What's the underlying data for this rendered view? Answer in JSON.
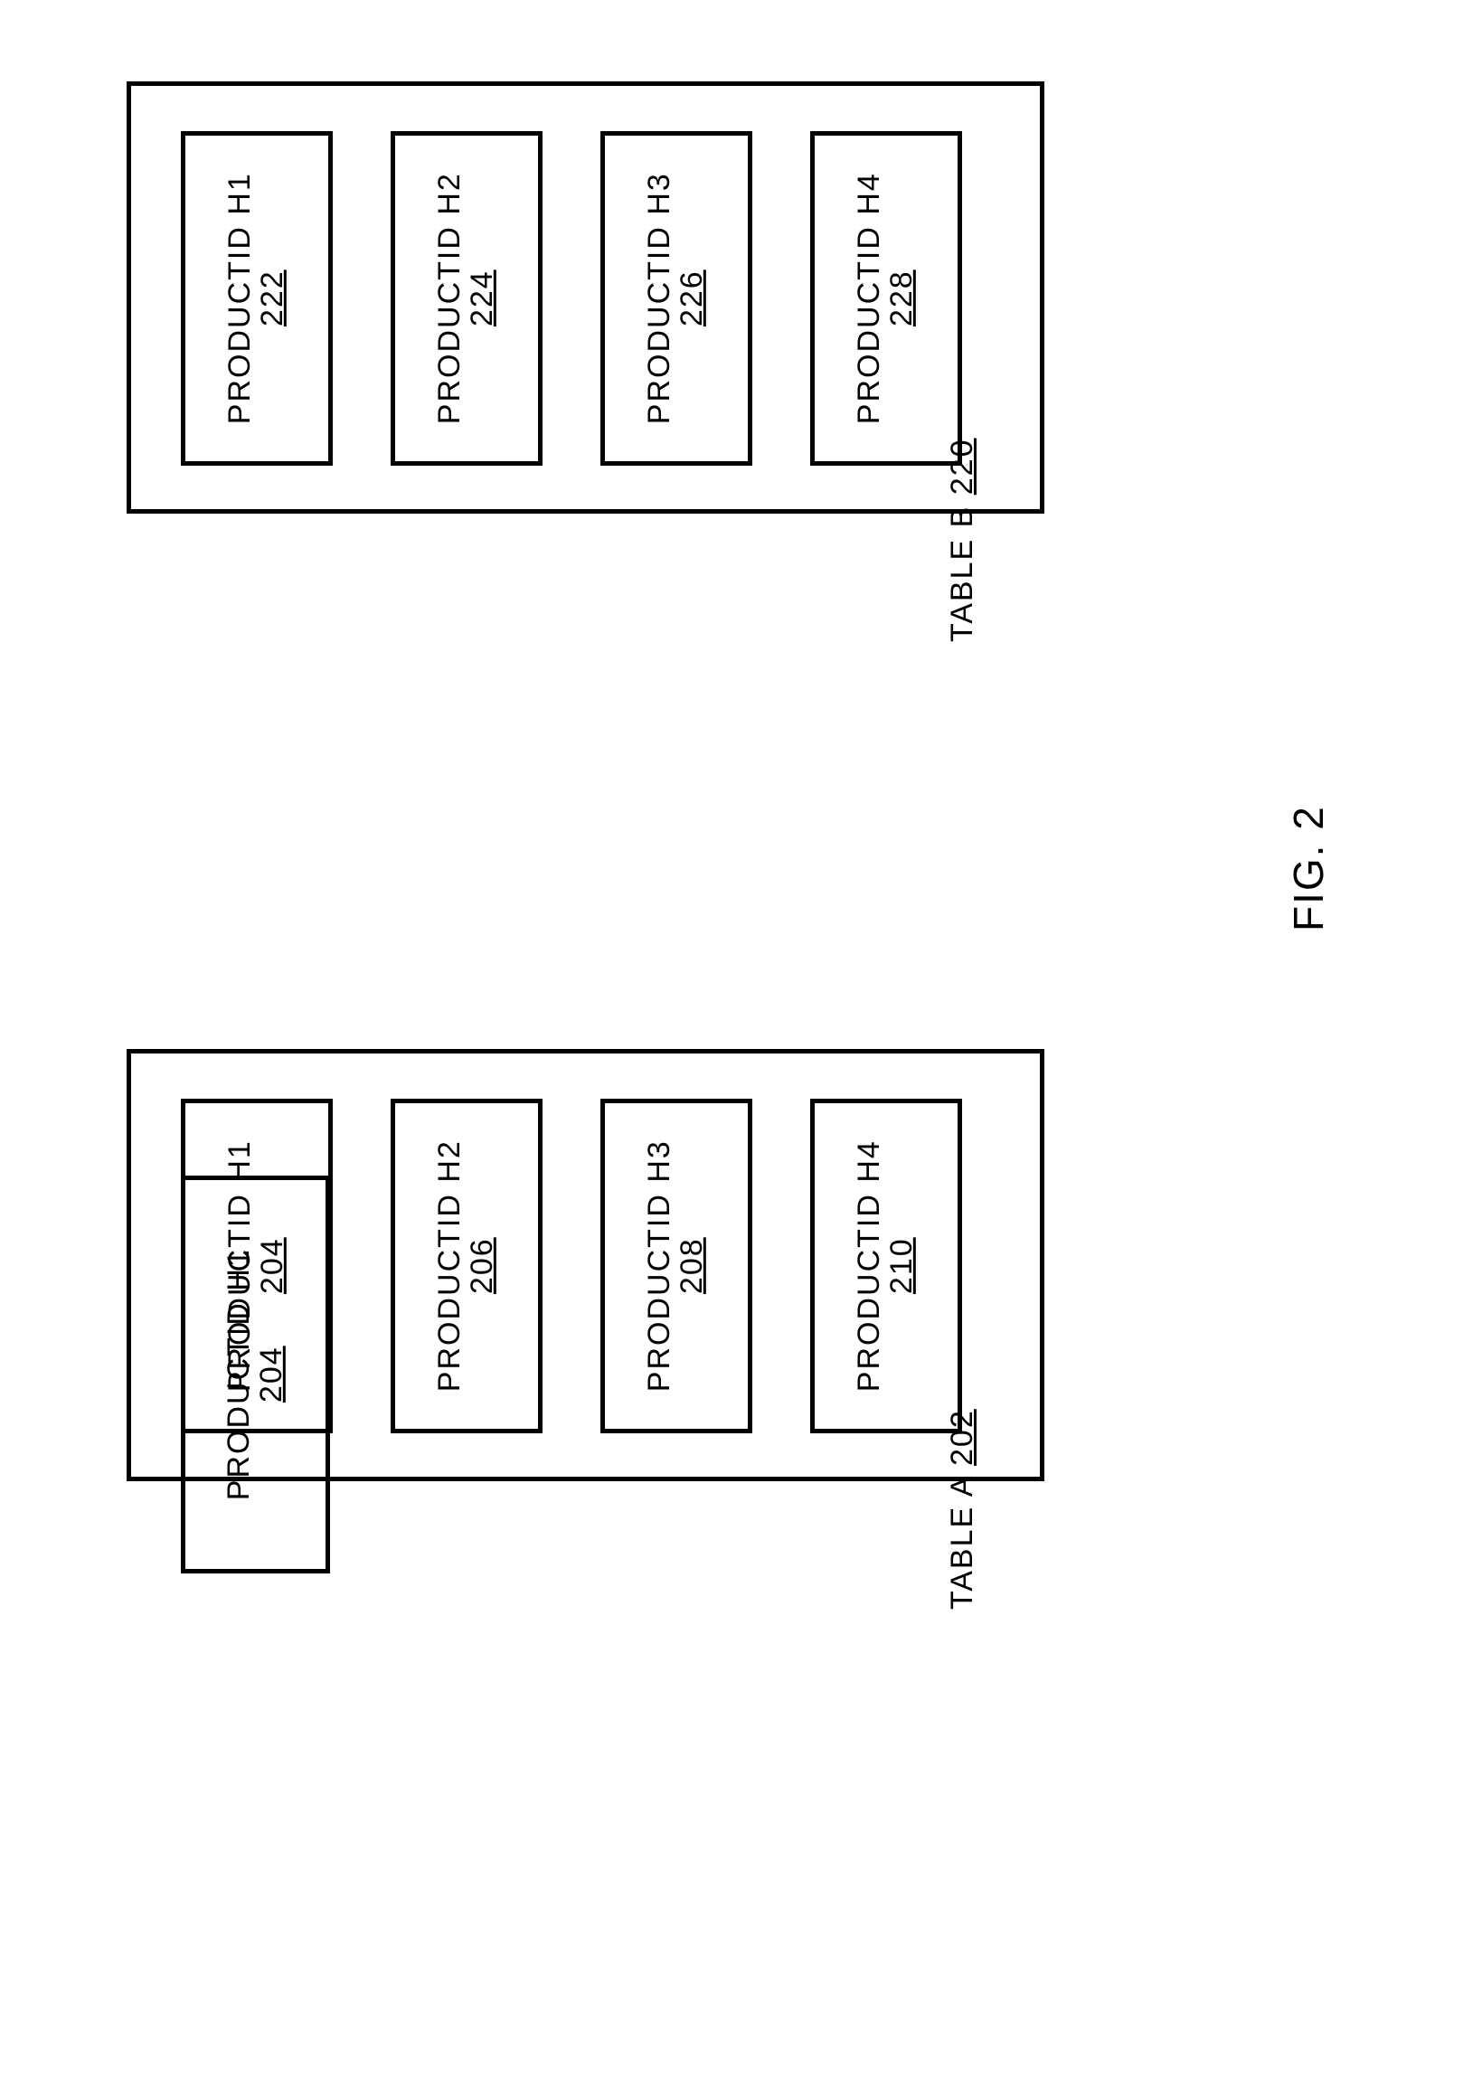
{
  "figure_label": "FIG. 2",
  "tables": [
    {
      "key": "A",
      "caption": "TABLE A",
      "caption_ref": "202",
      "rows": [
        {
          "label": "PRODUCTID H1",
          "ref": "204"
        },
        {
          "label": "PRODUCTID H2",
          "ref": "206"
        },
        {
          "label": "PRODUCTID H3",
          "ref": "208"
        },
        {
          "label": "PRODUCTID H4",
          "ref": "210"
        }
      ]
    },
    {
      "key": "B",
      "caption": "TABLE B",
      "caption_ref": "220",
      "rows": [
        {
          "label": "PRODUCTID H1",
          "ref": "222"
        },
        {
          "label": "PRODUCTID H2",
          "ref": "224"
        },
        {
          "label": "PRODUCTID H3",
          "ref": "226"
        },
        {
          "label": "PRODUCTID H4",
          "ref": "228"
        }
      ]
    }
  ]
}
